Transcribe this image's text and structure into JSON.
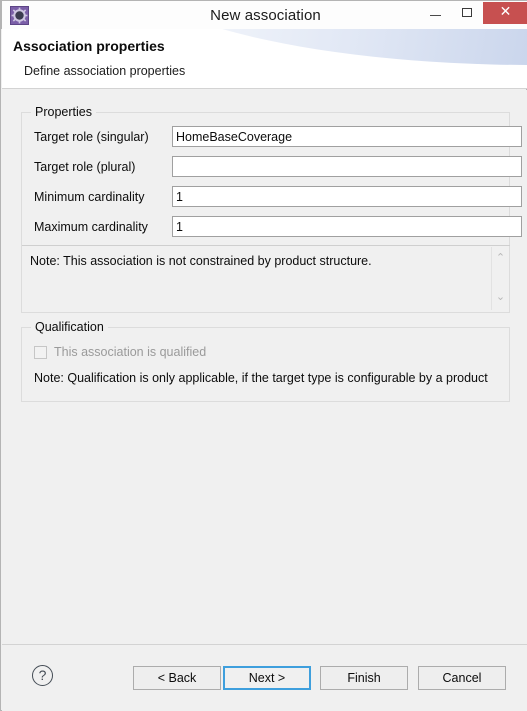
{
  "window": {
    "title": "New association",
    "icon": "association-gear-icon",
    "controls": {
      "minimize": "minimize-icon",
      "maximize": "maximize-icon",
      "close": "✕"
    }
  },
  "header": {
    "title": "Association properties",
    "subtitle": "Define association properties"
  },
  "properties_group": {
    "legend": "Properties",
    "fields": [
      {
        "label": "Target role (singular)",
        "value": "HomeBaseCoverage",
        "placeholder": ""
      },
      {
        "label": "Target role (plural)",
        "value": "",
        "placeholder": ""
      },
      {
        "label": "Minimum cardinality",
        "value": "1",
        "placeholder": ""
      },
      {
        "label": "Maximum cardinality",
        "value": "1",
        "placeholder": ""
      }
    ],
    "note": "Note: This association is not constrained by product structure.",
    "scroll_up": "⌃",
    "scroll_down": "⌄"
  },
  "qualification_group": {
    "legend": "Qualification",
    "checkbox_label": "This association is qualified",
    "checkbox_checked": false,
    "checkbox_enabled": false,
    "note": "Note: Qualification is only applicable, if the target type is configurable by a product"
  },
  "footer": {
    "help": "?",
    "buttons": [
      {
        "label": "< Back",
        "primary": false
      },
      {
        "label": "Next >",
        "primary": true
      },
      {
        "label": "Finish",
        "primary": false
      },
      {
        "label": "Cancel",
        "primary": false
      }
    ]
  },
  "colors": {
    "accent_focus": "#3e9fdd",
    "close_button": "#c75050",
    "dialog_background": "#f0f0f0",
    "header_background": "#ffffff"
  }
}
